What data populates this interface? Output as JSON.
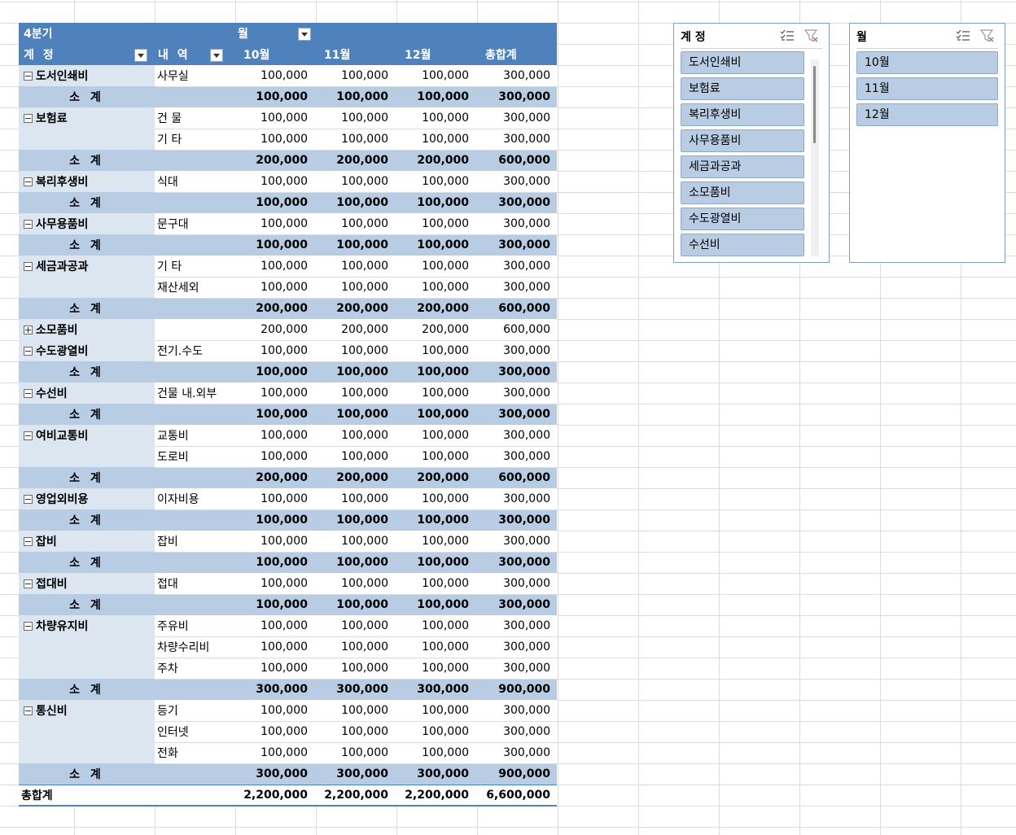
{
  "pivot": {
    "header1": {
      "corner": "4분기",
      "col_field": "월"
    },
    "header2": {
      "row_field1": "계 정",
      "row_field2": "내 역",
      "cols": [
        "10월",
        "11월",
        "12월",
        "총합계"
      ]
    },
    "subtotal_label": "소 계",
    "grand_total_label": "총합계",
    "groups": [
      {
        "account": "도서인쇄비",
        "expanded": true,
        "rows": [
          {
            "item": "사무실",
            "values": [
              "100,000",
              "100,000",
              "100,000",
              "300,000"
            ]
          }
        ],
        "subtotal": [
          "100,000",
          "100,000",
          "100,000",
          "300,000"
        ]
      },
      {
        "account": "보험료",
        "expanded": true,
        "rows": [
          {
            "item": "건 물",
            "values": [
              "100,000",
              "100,000",
              "100,000",
              "300,000"
            ]
          },
          {
            "item": "기 타",
            "values": [
              "100,000",
              "100,000",
              "100,000",
              "300,000"
            ]
          }
        ],
        "subtotal": [
          "200,000",
          "200,000",
          "200,000",
          "600,000"
        ]
      },
      {
        "account": "복리후생비",
        "expanded": true,
        "rows": [
          {
            "item": "식대",
            "values": [
              "100,000",
              "100,000",
              "100,000",
              "300,000"
            ]
          }
        ],
        "subtotal": [
          "100,000",
          "100,000",
          "100,000",
          "300,000"
        ]
      },
      {
        "account": "사무용품비",
        "expanded": true,
        "rows": [
          {
            "item": "문구대",
            "values": [
              "100,000",
              "100,000",
              "100,000",
              "300,000"
            ]
          }
        ],
        "subtotal": [
          "100,000",
          "100,000",
          "100,000",
          "300,000"
        ]
      },
      {
        "account": "세금과공과",
        "expanded": true,
        "rows": [
          {
            "item": "기 타",
            "values": [
              "100,000",
              "100,000",
              "100,000",
              "300,000"
            ]
          },
          {
            "item": "재산세외",
            "values": [
              "100,000",
              "100,000",
              "100,000",
              "300,000"
            ]
          }
        ],
        "subtotal": [
          "200,000",
          "200,000",
          "200,000",
          "600,000"
        ]
      },
      {
        "account": "소모품비",
        "expanded": false,
        "rows": [
          {
            "item": "",
            "values": [
              "200,000",
              "200,000",
              "200,000",
              "600,000"
            ]
          }
        ],
        "subtotal": null
      },
      {
        "account": "수도광열비",
        "expanded": true,
        "rows": [
          {
            "item": "전기.수도",
            "values": [
              "100,000",
              "100,000",
              "100,000",
              "300,000"
            ]
          }
        ],
        "subtotal": [
          "100,000",
          "100,000",
          "100,000",
          "300,000"
        ]
      },
      {
        "account": "수선비",
        "expanded": true,
        "rows": [
          {
            "item": "건물 내.외부",
            "values": [
              "100,000",
              "100,000",
              "100,000",
              "300,000"
            ]
          }
        ],
        "subtotal": [
          "100,000",
          "100,000",
          "100,000",
          "300,000"
        ]
      },
      {
        "account": "여비교통비",
        "expanded": true,
        "rows": [
          {
            "item": "교통비",
            "values": [
              "100,000",
              "100,000",
              "100,000",
              "300,000"
            ]
          },
          {
            "item": "도로비",
            "values": [
              "100,000",
              "100,000",
              "100,000",
              "300,000"
            ]
          }
        ],
        "subtotal": [
          "200,000",
          "200,000",
          "200,000",
          "600,000"
        ]
      },
      {
        "account": "영업외비용",
        "expanded": true,
        "rows": [
          {
            "item": "이자비용",
            "values": [
              "100,000",
              "100,000",
              "100,000",
              "300,000"
            ]
          }
        ],
        "subtotal": [
          "100,000",
          "100,000",
          "100,000",
          "300,000"
        ]
      },
      {
        "account": "잡비",
        "expanded": true,
        "rows": [
          {
            "item": "잡비",
            "values": [
              "100,000",
              "100,000",
              "100,000",
              "300,000"
            ]
          }
        ],
        "subtotal": [
          "100,000",
          "100,000",
          "100,000",
          "300,000"
        ]
      },
      {
        "account": "접대비",
        "expanded": true,
        "rows": [
          {
            "item": "접대",
            "values": [
              "100,000",
              "100,000",
              "100,000",
              "300,000"
            ]
          }
        ],
        "subtotal": [
          "100,000",
          "100,000",
          "100,000",
          "300,000"
        ]
      },
      {
        "account": "차량유지비",
        "expanded": true,
        "rows": [
          {
            "item": "주유비",
            "values": [
              "100,000",
              "100,000",
              "100,000",
              "300,000"
            ]
          },
          {
            "item": "차량수리비",
            "values": [
              "100,000",
              "100,000",
              "100,000",
              "300,000"
            ]
          },
          {
            "item": "주차",
            "values": [
              "100,000",
              "100,000",
              "100,000",
              "300,000"
            ]
          }
        ],
        "subtotal": [
          "300,000",
          "300,000",
          "300,000",
          "900,000"
        ]
      },
      {
        "account": "통신비",
        "expanded": true,
        "rows": [
          {
            "item": "등기",
            "values": [
              "100,000",
              "100,000",
              "100,000",
              "300,000"
            ]
          },
          {
            "item": "인터넷",
            "values": [
              "100,000",
              "100,000",
              "100,000",
              "300,000"
            ]
          },
          {
            "item": "전화",
            "values": [
              "100,000",
              "100,000",
              "100,000",
              "300,000"
            ]
          }
        ],
        "subtotal": [
          "300,000",
          "300,000",
          "300,000",
          "900,000"
        ]
      }
    ],
    "grand_total": [
      "2,200,000",
      "2,200,000",
      "2,200,000",
      "6,600,000"
    ]
  },
  "slicers": {
    "account": {
      "title": "계 정",
      "items": [
        "도서인쇄비",
        "보험료",
        "복리후생비",
        "사무용품비",
        "세금과공과",
        "소모품비",
        "수도광열비",
        "수선비"
      ]
    },
    "month": {
      "title": "월",
      "items": [
        "10월",
        "11월",
        "12월"
      ]
    }
  },
  "colors": {
    "header": "#4f81bd",
    "subtotal": "#b8cce4",
    "account_cell": "#dce6f1",
    "slicer_item": "#b8cce4"
  }
}
